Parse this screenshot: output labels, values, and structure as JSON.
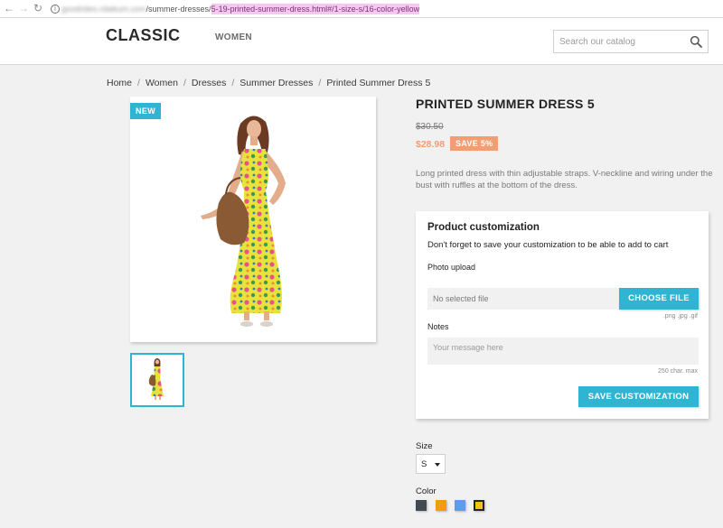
{
  "browser": {
    "url_host": "goodrides.rdaikum.com",
    "url_path": "/summer-dresses/",
    "url_highlight": "5-19-printed-summer-dress.html#/1-size-s/16-color-yellow"
  },
  "header": {
    "logo": "CLASSIC",
    "nav_women": "WOMEN",
    "search_placeholder": "Search our catalog"
  },
  "breadcrumb": [
    "Home",
    "Women",
    "Dresses",
    "Summer Dresses",
    "Printed Summer Dress 5"
  ],
  "product": {
    "badge_new": "NEW",
    "title": "PRINTED SUMMER DRESS 5",
    "old_price": "$30.50",
    "price": "$28.98",
    "discount": "SAVE 5%",
    "description": "Long printed dress with thin adjustable straps. V-neckline and wiring under the bust with ruffles at the bottom of the dress."
  },
  "customization": {
    "title": "Product customization",
    "note": "Don't forget to save your customization to be able to add to cart",
    "photo_label": "Photo upload",
    "file_placeholder": "No selected file",
    "choose_button": "CHOOSE FILE",
    "file_hint": ".png .jpg .gif",
    "notes_label": "Notes",
    "notes_placeholder": "Your message here",
    "notes_hint": "250 char. max",
    "save_button": "SAVE CUSTOMIZATION"
  },
  "variants": {
    "size_label": "Size",
    "size_value": "S",
    "color_label": "Color",
    "colors": [
      {
        "name": "Grey",
        "hex": "#434a54"
      },
      {
        "name": "Orange",
        "hex": "#f39c11"
      },
      {
        "name": "Blue",
        "hex": "#5d9cec"
      },
      {
        "name": "Yellow",
        "hex": "#f1c40f",
        "selected": true
      }
    ]
  },
  "colors": {
    "accent": "#2fb5d2",
    "discount": "#f39d72"
  }
}
